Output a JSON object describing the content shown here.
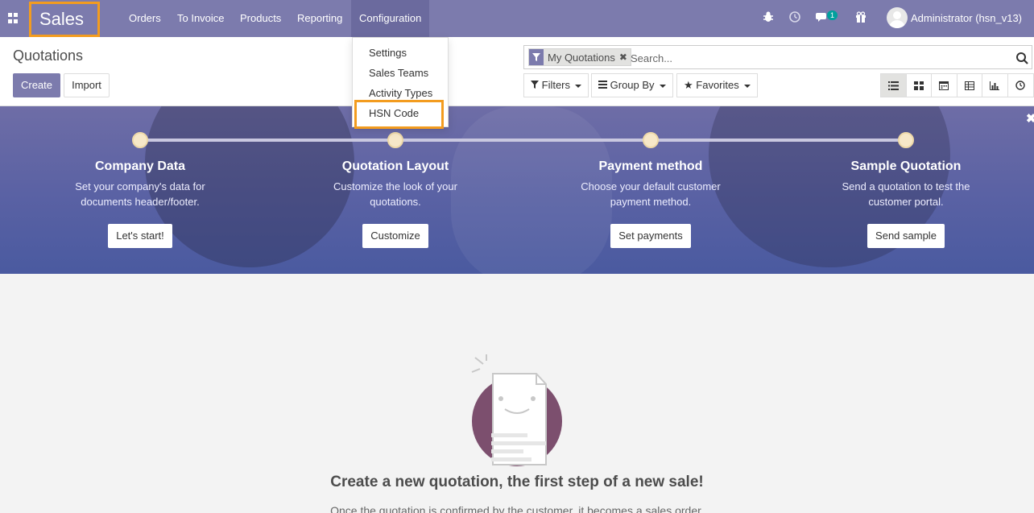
{
  "navbar": {
    "app_name": "Sales",
    "menu": [
      "Orders",
      "To Invoice",
      "Products",
      "Reporting",
      "Configuration"
    ],
    "messages_count": "1",
    "user": "Administrator (hsn_v13)"
  },
  "control_panel": {
    "title": "Quotations",
    "create_label": "Create",
    "import_label": "Import",
    "search": {
      "facet": "My Quotations",
      "placeholder": "Search..."
    },
    "filters_label": "Filters",
    "group_by_label": "Group By",
    "favorites_label": "Favorites"
  },
  "config_dropdown": {
    "items": [
      "Settings",
      "Sales Teams",
      "Activity Types",
      "HSN Code"
    ]
  },
  "onboarding": {
    "steps": [
      {
        "title": "Company Data",
        "desc": "Set your company's data for documents header/footer.",
        "button": "Let's start!"
      },
      {
        "title": "Quotation Layout",
        "desc": "Customize the look of your quotations.",
        "button": "Customize"
      },
      {
        "title": "Payment method",
        "desc": "Choose your default customer payment method.",
        "button": "Set payments"
      },
      {
        "title": "Sample Quotation",
        "desc": "Send a quotation to test the customer portal.",
        "button": "Send sample"
      }
    ]
  },
  "empty_state": {
    "title": "Create a new quotation, the first step of a new sale!",
    "subtitle": "Once the quotation is confirmed by the customer, it becomes a sales order."
  },
  "colors": {
    "brand": "#7c7bad",
    "highlight": "#f39c1f",
    "badge": "#00a09d"
  }
}
